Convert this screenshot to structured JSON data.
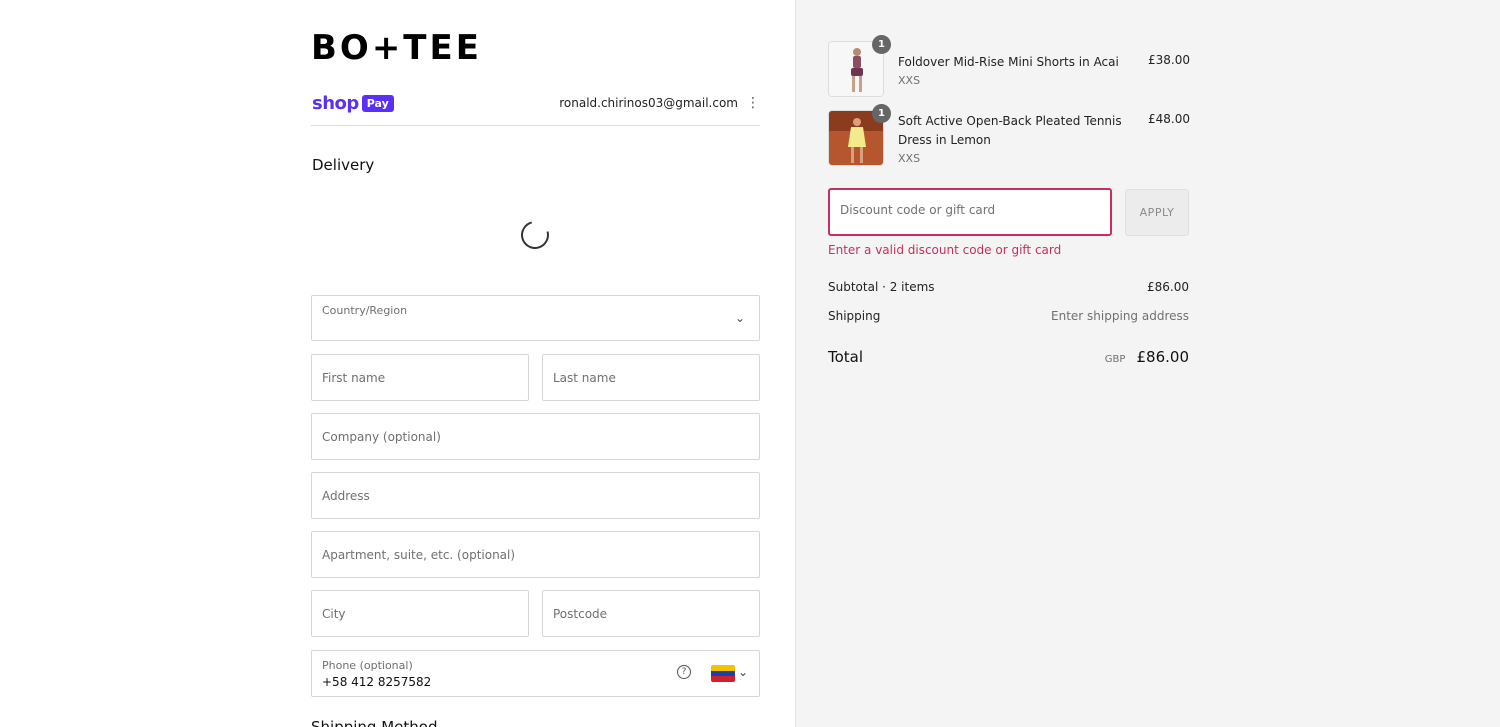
{
  "brand": {
    "logo": "BO+TEE"
  },
  "shop_pay": {
    "word": "shop",
    "pay": "Pay"
  },
  "account": {
    "email": "ronald.chirinos03@gmail.com",
    "menu_icon": "kebab-menu-icon"
  },
  "delivery": {
    "heading": "Delivery",
    "country_label": "Country/Region",
    "first_name": "First name",
    "last_name": "Last name",
    "company": "Company (optional)",
    "address": "Address",
    "apartment": "Apartment, suite, etc. (optional)",
    "city": "City",
    "postcode": "Postcode",
    "phone_label": "Phone (optional)",
    "phone_value": "+58 412 8257582",
    "next_heading_partial": "Shipping Method"
  },
  "cart": {
    "items": [
      {
        "name": "Foldover Mid-Rise Mini Shorts in Acai",
        "variant": "XXS",
        "price": "£38.00",
        "qty": "1"
      },
      {
        "name": "Soft Active Open-Back Pleated Tennis Dress in Lemon",
        "variant": "XXS",
        "price": "£48.00",
        "qty": "1"
      }
    ]
  },
  "discount": {
    "placeholder": "Discount code or gift card",
    "apply": "APPLY",
    "error": "Enter a valid discount code or gift card"
  },
  "summary": {
    "subtotal_label": "Subtotal · 2 items",
    "subtotal_value": "£86.00",
    "shipping_label": "Shipping",
    "shipping_value": "Enter shipping address",
    "total_label": "Total",
    "currency": "GBP",
    "total_value": "£86.00"
  },
  "colors": {
    "accent": "#5a31f4",
    "error": "#c7305b",
    "sidebar_bg": "#f4f4f4"
  }
}
